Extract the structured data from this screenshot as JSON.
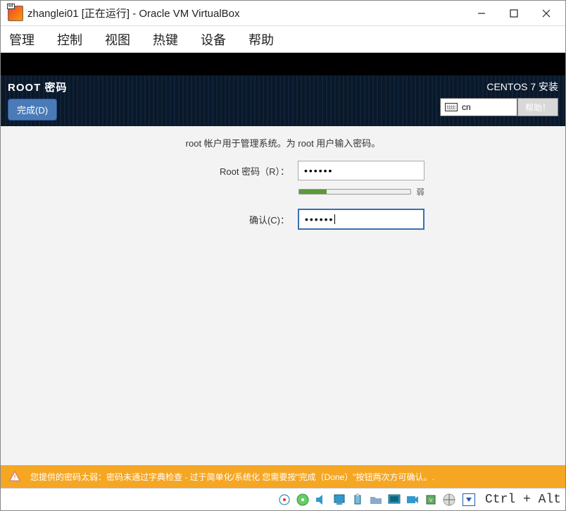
{
  "window": {
    "title": "zhanglei01 [正在运行] - Oracle VM VirtualBox"
  },
  "menubar": {
    "items": [
      "管理",
      "控制",
      "视图",
      "热键",
      "设备",
      "帮助"
    ]
  },
  "header": {
    "title": "ROOT 密码",
    "done_button": "完成(D)",
    "subtitle": "CENTOS 7 安装",
    "lang": "cn",
    "help_button": "帮助！"
  },
  "form": {
    "instruction": "root 帐户用于管理系统。为 root 用户输入密码。",
    "root_label": "Root 密码（R）：",
    "root_value": "••••••",
    "confirm_label": "确认(C)：",
    "confirm_value": "••••••",
    "strength_label": "弱"
  },
  "warning": {
    "text": "您提供的密码太弱：密码未通过字典检查 - 过于简单化/系统化 您需要按\"完成（Done）\"按钮两次方可确认。."
  },
  "statusbar": {
    "host_key": "Ctrl + Alt"
  }
}
